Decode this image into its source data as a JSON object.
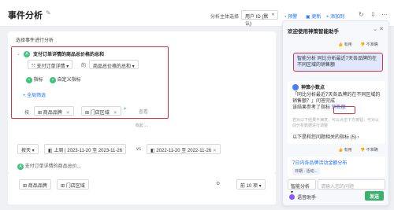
{
  "header": {
    "title": "事件分析",
    "subject_label": "分析主体选择",
    "subject_value": "用户 ID (默认)",
    "toolbar": [
      "预警",
      "更新",
      "添加到"
    ]
  },
  "analysis": {
    "section_label": "选择事件进行分析",
    "event_title": "支付订单详情的商品总价格的总和",
    "event_name": "支付订单详情",
    "of_label": "的",
    "measure": "商品总价格的总和",
    "metric_btn": "指标",
    "custom_metric_btn": "自定义指标",
    "global_filter": "全局筛选",
    "group_by_label": "按",
    "group_by": [
      "商品品牌",
      "门店区域"
    ],
    "more_label": "查看",
    "toggle_label": "收起"
  },
  "date_filter": {
    "granularity": "按天",
    "current": "上周 | 2023-11-20 至 2023-11-26",
    "vs": "vs",
    "compare": "2022-11-20 至 2022-11-26",
    "metric_line": "支付订单详情的商品总价..."
  },
  "result": {
    "dims": [
      "商品品牌",
      "门店区域"
    ],
    "rows_label": "前 10 项"
  },
  "assistant": {
    "title": "欢迎使用神策智能助手",
    "like": "有用",
    "dislike": "不准确",
    "user_msg": "智能分析 同比分析最近7天各品牌的在不同区域的销售额",
    "bot_name": "神策小数点",
    "bot_text_1": "「同比分析最近7天各品牌的在不同区域的销售额？」问答完成",
    "bot_text_2": "该结果参考了指标",
    "bot_highlight": "销售额",
    "faded_text": "若对以下结果不满意，可以点击下方按钮，可对以前分析数据进行调整",
    "bot_more": "以下是和您问题相关的指标 (5)",
    "suggest_title": "7日内各品牌活动金额分布",
    "suggest_tag": "日期 · 活动...",
    "mode": "智能分析",
    "input_placeholder": "请输入您的问题",
    "voice_label": "语音助手",
    "send_label": "发送"
  }
}
